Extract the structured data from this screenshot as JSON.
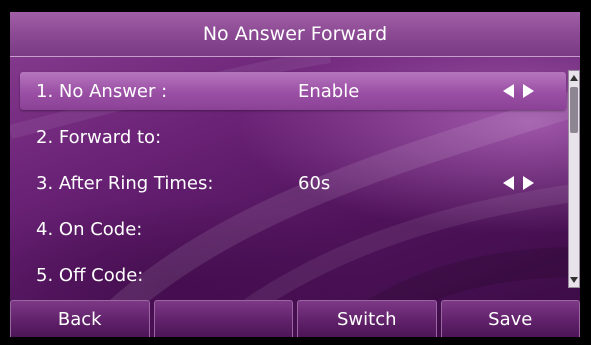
{
  "screen": {
    "title": "No Answer Forward"
  },
  "menu": {
    "items": [
      {
        "label": "1. No Answer :",
        "value": "Enable",
        "has_arrows": true,
        "selected": true
      },
      {
        "label": "2. Forward to:",
        "value": "",
        "has_arrows": false,
        "selected": false
      },
      {
        "label": "3. After Ring Times:",
        "value": "60s",
        "has_arrows": true,
        "selected": false
      },
      {
        "label": "4. On Code:",
        "value": "",
        "has_arrows": false,
        "selected": false
      },
      {
        "label": "5. Off Code:",
        "value": "",
        "has_arrows": false,
        "selected": false
      }
    ]
  },
  "softkeys": [
    {
      "label": "Back"
    },
    {
      "label": ""
    },
    {
      "label": "Switch"
    },
    {
      "label": "Save"
    }
  ],
  "icons": {
    "left_arrow": "left-arrow-icon",
    "right_arrow": "right-arrow-icon",
    "scroll_up": "scroll-up-icon",
    "scroll_down": "scroll-down-icon"
  },
  "colors": {
    "background": "#6a2276",
    "title_bar": "#8b4a93",
    "selected_row": "#9a4fa4",
    "text": "#ffffff"
  }
}
